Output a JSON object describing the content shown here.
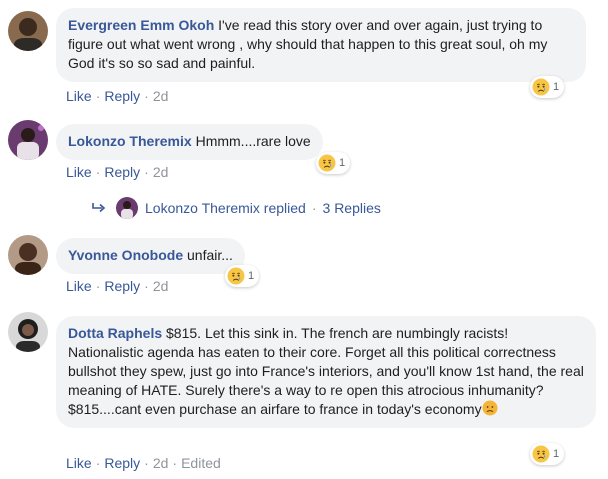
{
  "comments": [
    {
      "author": "Evergreen Emm Okoh",
      "text": "I've read this story over and over again, just trying to figure out what went wrong , why should that happen to this great soul, oh my God it's so so sad and painful.",
      "reaction_count": "1",
      "like": "Like",
      "reply": "Reply",
      "time": "2d"
    },
    {
      "author": "Lokonzo Theremix",
      "text": "Hmmm....rare love",
      "reaction_count": "1",
      "like": "Like",
      "reply": "Reply",
      "time": "2d"
    },
    {
      "author": "Yvonne Onobode",
      "text": "unfair...",
      "reaction_count": "1",
      "like": "Like",
      "reply": "Reply",
      "time": "2d"
    },
    {
      "author": "Dotta Raphels",
      "text": "$815. Let this sink in. The french are numbingly racists! Nationalistic agenda has eaten to their core. Forget all this political correctness bullshot they spew, just go into France's interiors, and you'll know 1st hand, the real meaning of HATE. Surely there's a way to re open this atrocious inhumanity? $815....cant even purchase an airfare to france in today's economy",
      "reaction_count": "1",
      "like": "Like",
      "reply": "Reply",
      "time": "2d",
      "edited": "Edited"
    }
  ],
  "replies": {
    "text": "Lokonzo Theremix replied",
    "count": "3 Replies"
  },
  "icons": {
    "reaction": "sad-reaction-icon",
    "reply_arrow": "reply-arrow-icon",
    "inline_emoji": "disappointed-emoji-icon"
  },
  "colors": {
    "link": "#385898",
    "bubble": "#f2f3f5",
    "meta": "#90949c"
  }
}
